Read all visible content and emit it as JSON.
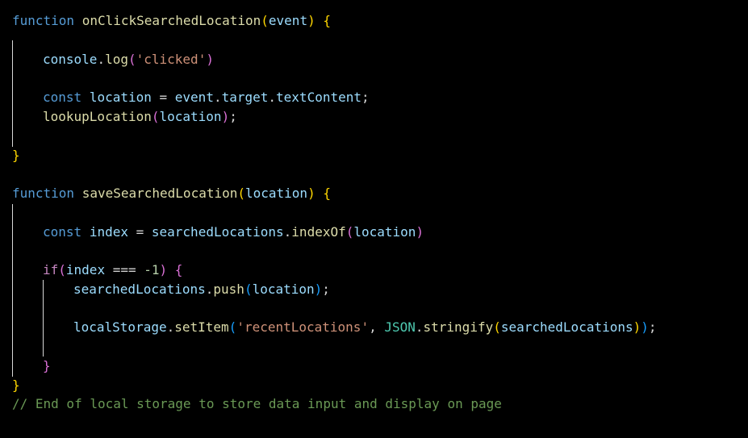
{
  "code": {
    "l1": {
      "kw": "function",
      "name": "onClickSearchedLocation",
      "open": "(",
      "param": "event",
      "close": ")",
      "brace": "{"
    },
    "l2": {
      "obj": "console",
      "dot": ".",
      "method": "log",
      "open": "(",
      "str": "'clicked'",
      "close": ")"
    },
    "l3": {
      "kw": "const",
      "var": "location",
      "eq": " = ",
      "obj": "event",
      "dot1": ".",
      "prop1": "target",
      "dot2": ".",
      "prop2": "textContent",
      "semi": ";"
    },
    "l4": {
      "fn": "lookupLocation",
      "open": "(",
      "arg": "location",
      "close": ")",
      "semi": ";"
    },
    "l5": {
      "brace": "}"
    },
    "l6": {
      "kw": "function",
      "name": "saveSearchedLocation",
      "open": "(",
      "param": "location",
      "close": ")",
      "brace": "{"
    },
    "l7": {
      "kw": "const",
      "var": "index",
      "eq": " = ",
      "obj": "searchedLocations",
      "dot": ".",
      "method": "indexOf",
      "open": "(",
      "arg": "location",
      "close": ")"
    },
    "l8": {
      "kw": "if",
      "open": "(",
      "var": "index",
      "op": " === ",
      "num": "-1",
      "close": ")",
      "brace": "{"
    },
    "l9": {
      "obj": "searchedLocations",
      "dot": ".",
      "method": "push",
      "open": "(",
      "arg": "location",
      "close": ")",
      "semi": ";"
    },
    "l10": {
      "obj": "localStorage",
      "dot1": ".",
      "method": "setItem",
      "open": "(",
      "str": "'recentLocations'",
      "comma": ", ",
      "cls": "JSON",
      "dot2": ".",
      "method2": "stringify",
      "open2": "(",
      "arg": "searchedLocations",
      "close2": ")",
      "close": ")",
      "semi": ";"
    },
    "l11": {
      "brace": "}"
    },
    "l12": {
      "brace": "}"
    },
    "l13": {
      "comment": "// End of local storage to store data input and display on page"
    }
  }
}
